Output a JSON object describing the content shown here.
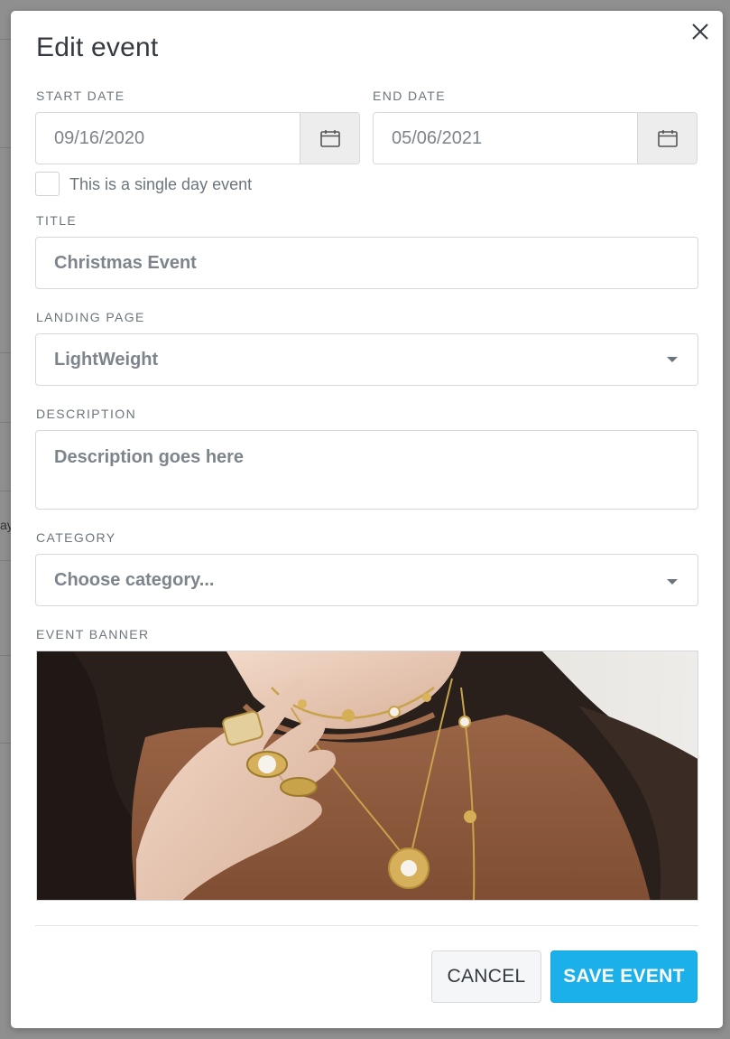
{
  "dialog": {
    "title": "Edit event",
    "close_icon": "close-icon"
  },
  "start_date": {
    "label": "START DATE",
    "value": "09/16/2020",
    "icon": "calendar-icon"
  },
  "end_date": {
    "label": "END DATE",
    "value": "05/06/2021",
    "icon": "calendar-icon"
  },
  "single_day": {
    "label": "This is a single day event",
    "checked": false
  },
  "title_field": {
    "label": "TITLE",
    "value": "Christmas Event"
  },
  "landing_page": {
    "label": "LANDING PAGE",
    "selected": "LightWeight"
  },
  "description": {
    "label": "DESCRIPTION",
    "placeholder": "Description goes here"
  },
  "category": {
    "label": "CATEGORY",
    "placeholder": "Choose category..."
  },
  "event_banner": {
    "label": "EVENT BANNER"
  },
  "actions": {
    "cancel_label": "CANCEL",
    "save_label": "SAVE EVENT"
  },
  "colors": {
    "primary": "#1cb0ea",
    "overlay": "#8f8f8f",
    "label_text": "#6c757d"
  },
  "background_page": {
    "partial_text": "ay"
  }
}
